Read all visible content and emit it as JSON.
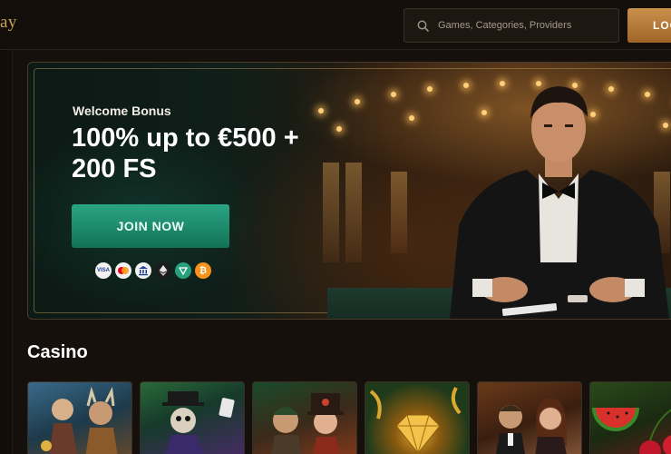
{
  "header": {
    "logo_text": "ay",
    "search_placeholder": "Games, Categories, Providers",
    "login_label": "LOG"
  },
  "banner": {
    "subtitle": "Welcome Bonus",
    "title": "100% up to €500 + 200 FS",
    "join_label": "JOIN NOW",
    "payment_methods": [
      {
        "icon": "visa-icon",
        "label": "VISA"
      },
      {
        "icon": "mastercard-icon",
        "label": ""
      },
      {
        "icon": "bank-icon",
        "label": ""
      },
      {
        "icon": "ethereum-icon",
        "label": ""
      },
      {
        "icon": "tether-icon",
        "label": ""
      },
      {
        "icon": "bitcoin-icon",
        "label": ""
      }
    ]
  },
  "casino": {
    "section_title": "Casino",
    "tiles": [
      {
        "icon": "viking-game-icon"
      },
      {
        "icon": "skeleton-game-icon"
      },
      {
        "icon": "adventurer-game-icon"
      },
      {
        "icon": "diamond-game-icon"
      },
      {
        "icon": "couple-game-icon"
      },
      {
        "icon": "fruit-game-icon"
      }
    ]
  },
  "colors": {
    "accent_gold": "#c9a25a",
    "join_green": "#1f8c6c",
    "login_orange": "#b87a38",
    "background": "#15100c"
  }
}
